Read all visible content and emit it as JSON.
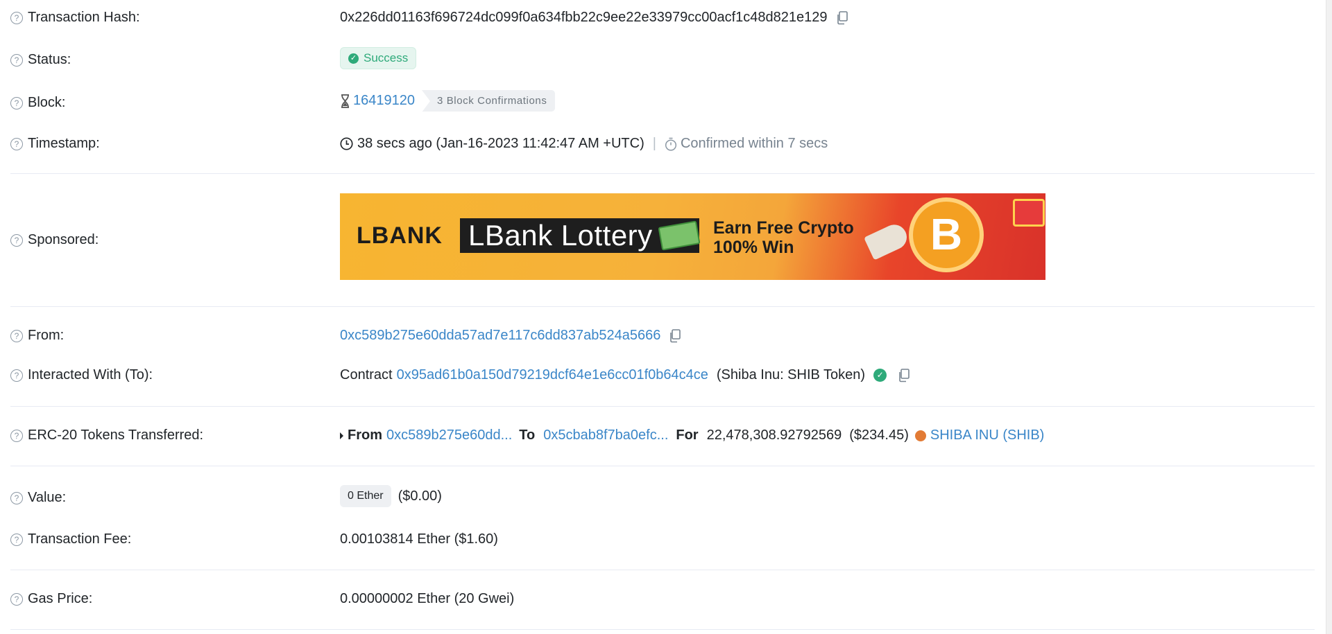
{
  "rows": {
    "tx_hash": {
      "label": "Transaction Hash:",
      "value": "0x226dd01163f696724dc099f0a634fbb22c9ee22e33979cc00acf1c48d821e129"
    },
    "status": {
      "label": "Status:",
      "value": "Success"
    },
    "block": {
      "label": "Block:",
      "number": "16419120",
      "confirmations": "3 Block Confirmations"
    },
    "timestamp": {
      "label": "Timestamp:",
      "value": "38 secs ago (Jan-16-2023 11:42:47 AM +UTC)",
      "separator": "|",
      "confirmed": "Confirmed within 7 secs"
    },
    "sponsored": {
      "label": "Sponsored:",
      "brand": "LBANK",
      "headline": "LBank Lottery",
      "tagline_1": "Earn Free Crypto",
      "tagline_2": "100% Win",
      "coin_symbol": "B"
    },
    "from": {
      "label": "From:",
      "address": "0xc589b275e60dda57ad7e117c6dd837ab524a5666"
    },
    "interacted": {
      "label": "Interacted With (To):",
      "prefix": "Contract",
      "address": "0x95ad61b0a150d79219dcf64e1e6cc01f0b64c4ce",
      "name": "(Shiba Inu: SHIB Token)"
    },
    "erc20": {
      "label": "ERC-20 Tokens Transferred:",
      "from_label": "From",
      "from_address": "0xc589b275e60dd...",
      "to_label": "To",
      "to_address": "0x5cbab8f7ba0efc...",
      "for_label": "For",
      "amount": "22,478,308.92792569",
      "usd": "($234.45)",
      "token": "SHIBA INU (SHIB)"
    },
    "value": {
      "label": "Value:",
      "amount": "0 Ether",
      "usd": "($0.00)"
    },
    "fee": {
      "label": "Transaction Fee:",
      "value": "0.00103814 Ether ($1.60)"
    },
    "gas": {
      "label": "Gas Price:",
      "value": "0.00000002 Ether (20 Gwei)"
    }
  },
  "help_glyph": "?",
  "icons": {
    "copy": "copy-icon",
    "help": "question-circle-icon",
    "hourglass": "hourglass-icon",
    "clock": "clock-icon",
    "timer": "stopwatch-icon",
    "verified": "check-circle-icon",
    "token": "shiba-inu-token-icon"
  },
  "colors": {
    "link": "#3a86c8",
    "success": "#2eaa7a",
    "muted": "#77838f"
  }
}
